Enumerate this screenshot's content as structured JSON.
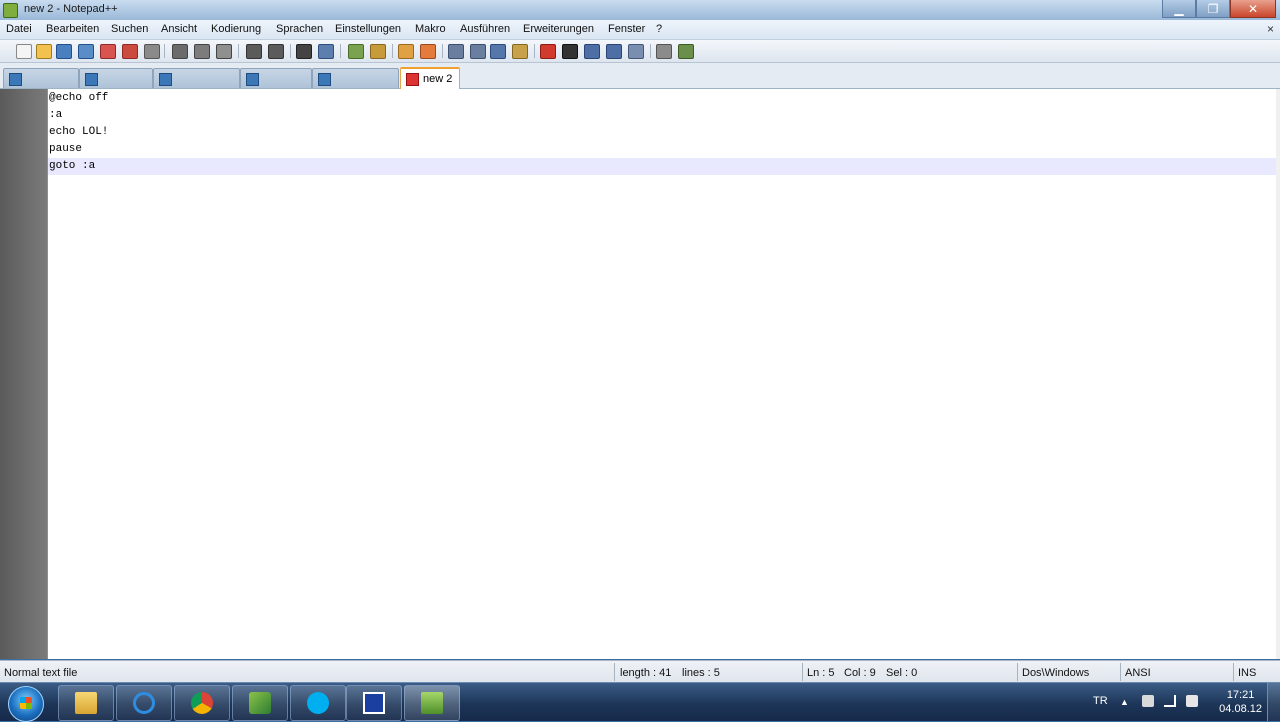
{
  "window": {
    "title": "new  2 - Notepad++",
    "controls": {
      "minimize": "▁",
      "maximize": "❐",
      "close": "✕"
    }
  },
  "menu": {
    "items": [
      "Datei",
      "Bearbeiten",
      "Suchen",
      "Ansicht",
      "Kodierung",
      "Sprachen",
      "Einstellungen",
      "Makro",
      "Ausführen",
      "Erweiterungen",
      "Fenster",
      "?"
    ],
    "close_doc": "×"
  },
  "tabs": {
    "items": [
      {
        "label": "",
        "state": "inactive"
      },
      {
        "label": "",
        "state": "inactive"
      },
      {
        "label": "",
        "state": "inactive"
      },
      {
        "label": "",
        "state": "inactive"
      },
      {
        "label": "",
        "state": "inactive"
      },
      {
        "label": "new 2",
        "state": "active-unsaved"
      }
    ]
  },
  "editor": {
    "lines": [
      "@echo off",
      ":a",
      "echo LOL!",
      "pause",
      "goto :a"
    ],
    "current_line": 5
  },
  "statusbar": {
    "file_type": "Normal text file",
    "length": "length : 41",
    "lines": "lines : 5",
    "ln": "Ln : 5",
    "col": "Col : 9",
    "sel": "Sel : 0",
    "eol": "Dos\\Windows",
    "encoding": "ANSI",
    "mode": "INS"
  },
  "taskbar": {
    "apps": [
      "explorer-icon",
      "internet-explorer-icon",
      "chrome-icon",
      "network-app-icon",
      "skype-icon",
      "blue-app-icon",
      "notepadpp-icon"
    ],
    "tray": {
      "language": "TR",
      "arrow": "▲"
    },
    "clock": {
      "time": "17:21",
      "date": "04.08.12"
    }
  },
  "colors": {
    "current_line": "#e8e8ff",
    "active_tab_accent": "#f0a030",
    "taskbar": "#1d3658"
  }
}
